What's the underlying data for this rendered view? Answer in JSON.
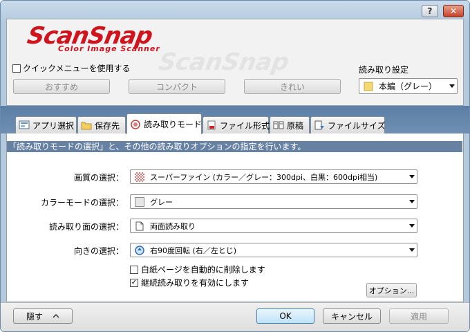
{
  "titlebar": {
    "help_label": "?",
    "close_label": "✕"
  },
  "logo": {
    "brand": "ScanSnap",
    "tagline": "Color Image Scanner"
  },
  "quick_menu": {
    "label": "クイックメニューを使用する",
    "checked": false
  },
  "presets": [
    "おすすめ",
    "コンパクト",
    "きれい"
  ],
  "scan_settings": {
    "label": "読み取り設定",
    "value": "本編（グレー）"
  },
  "tabs": [
    {
      "label": "アプリ選択",
      "icon": "app-icon"
    },
    {
      "label": "保存先",
      "icon": "folder-icon"
    },
    {
      "label": "読み取りモード",
      "icon": "scan-mode-icon",
      "active": true
    },
    {
      "label": "ファイル形式",
      "icon": "pdf-file-icon"
    },
    {
      "label": "原稿",
      "icon": "document-icon"
    },
    {
      "label": "ファイルサイズ",
      "icon": "file-size-icon"
    }
  ],
  "banner": "「読み取りモードの選択」と、その他の読み取りオプションの指定を行います。",
  "fields": [
    {
      "label": "画質の選択：",
      "value": "スーパーファイン (カラー／グレー：300dpi、白黒：600dpi相当)",
      "icon": "quality-icon"
    },
    {
      "label": "カラーモードの選択：",
      "value": "グレー",
      "icon": "gray-swatch-icon"
    },
    {
      "label": "読み取り面の選択：",
      "value": "両面読み取り",
      "icon": "duplex-icon"
    },
    {
      "label": "向きの選択：",
      "value": "右90度回転 (右／左とじ)",
      "icon": "rotate-icon"
    }
  ],
  "options": [
    {
      "label": "白紙ページを自動的に削除します",
      "checked": false
    },
    {
      "label": "継続読み取りを有効にします",
      "checked": true
    }
  ],
  "option_button": "オプション...",
  "footer": {
    "hide": "隠す",
    "ok": "OK",
    "cancel": "キャンセル",
    "apply": "適用"
  },
  "colors": {
    "brand_red": "#d0141e",
    "banner_bg": "#6781a3",
    "tabstrip_bg": "#5c7fa5"
  }
}
